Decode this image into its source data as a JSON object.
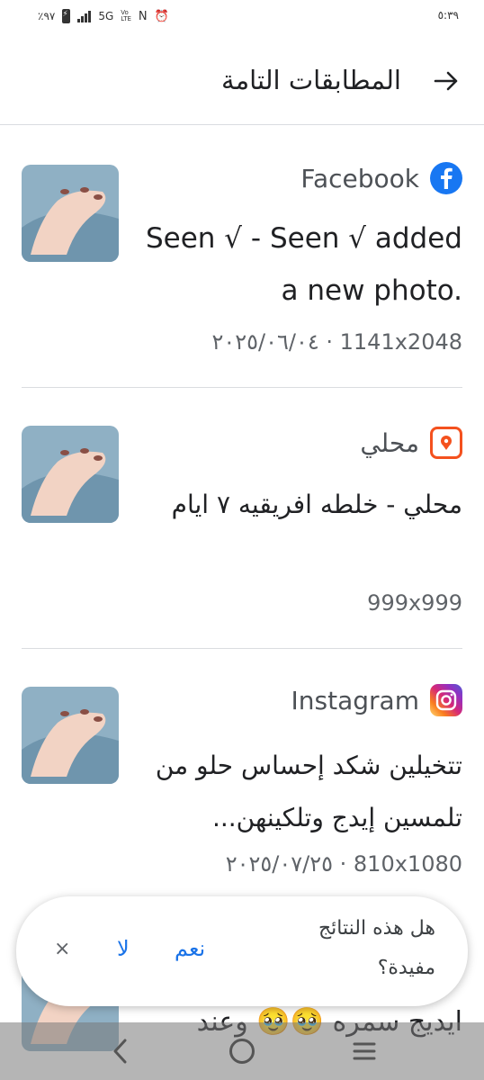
{
  "status": {
    "battery": "٪٩٧",
    "network": "5G",
    "volte": "VoLTE",
    "time": "٥:٣٩"
  },
  "header": {
    "title": "المطابقات التامة"
  },
  "results": [
    {
      "source": "Facebook",
      "icon": "facebook-icon",
      "title": "Seen √ - Seen √ added a new photo.",
      "meta": "1141x2048 · ٢٠٢٥/٠٦/٠٤"
    },
    {
      "source": "محلي",
      "icon": "mahally-icon",
      "title": "محلي - خلطه افريقيه ٧ ايام",
      "meta": "999x999"
    },
    {
      "source": "Instagram",
      "icon": "instagram-icon",
      "title": "تتخيلين شكد إحساس حلو من تلمسين إيدج وتلكينهن...",
      "meta": "810x1080 · ٢٠٢٥/٠٧/٢٥"
    }
  ],
  "peek": {
    "text": "ايديج سمره 🥹🥹 وعند"
  },
  "feedback": {
    "question": "هل هذه النتائج مفيدة؟",
    "yes": "نعم",
    "no": "لا",
    "close": "×"
  },
  "colors": {
    "accent": "#1a73e8",
    "divider": "#dadce0",
    "facebook": "#1877f2",
    "mahally": "#f4511e"
  }
}
